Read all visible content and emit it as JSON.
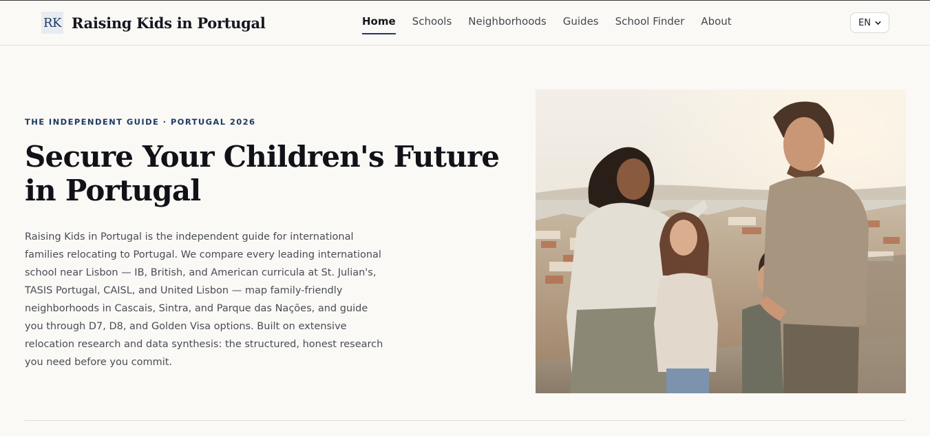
{
  "brand": {
    "mark": "RK",
    "name": "Raising Kids in Portugal"
  },
  "nav": {
    "items": [
      {
        "label": "Home",
        "active": true
      },
      {
        "label": "Schools",
        "active": false
      },
      {
        "label": "Neighborhoods",
        "active": false
      },
      {
        "label": "Guides",
        "active": false
      },
      {
        "label": "School Finder",
        "active": false
      },
      {
        "label": "About",
        "active": false
      }
    ]
  },
  "language": {
    "selected": "EN"
  },
  "hero": {
    "eyebrow": "THE INDEPENDENT GUIDE · PORTUGAL 2026",
    "title": "Secure Your Children's Future in Portugal",
    "body": "Raising Kids in Portugal is the independent guide for international families relocating to Portugal. We compare every leading international school near Lisbon — IB, British, and American curricula at St. Julian's, TASIS Portugal, CAISL, and United Lisbon — map family-friendly neighborhoods in Cascais, Sintra, and Parque das Nações, and guide you through D7, D8, and Golden Visa options. Built on extensive relocation research and data synthesis: the structured, honest research you need before you commit."
  },
  "colors": {
    "accent": "#1f3a63",
    "background": "#faf9f6"
  },
  "icons": {
    "language_chevron": "chevron-down-icon"
  }
}
